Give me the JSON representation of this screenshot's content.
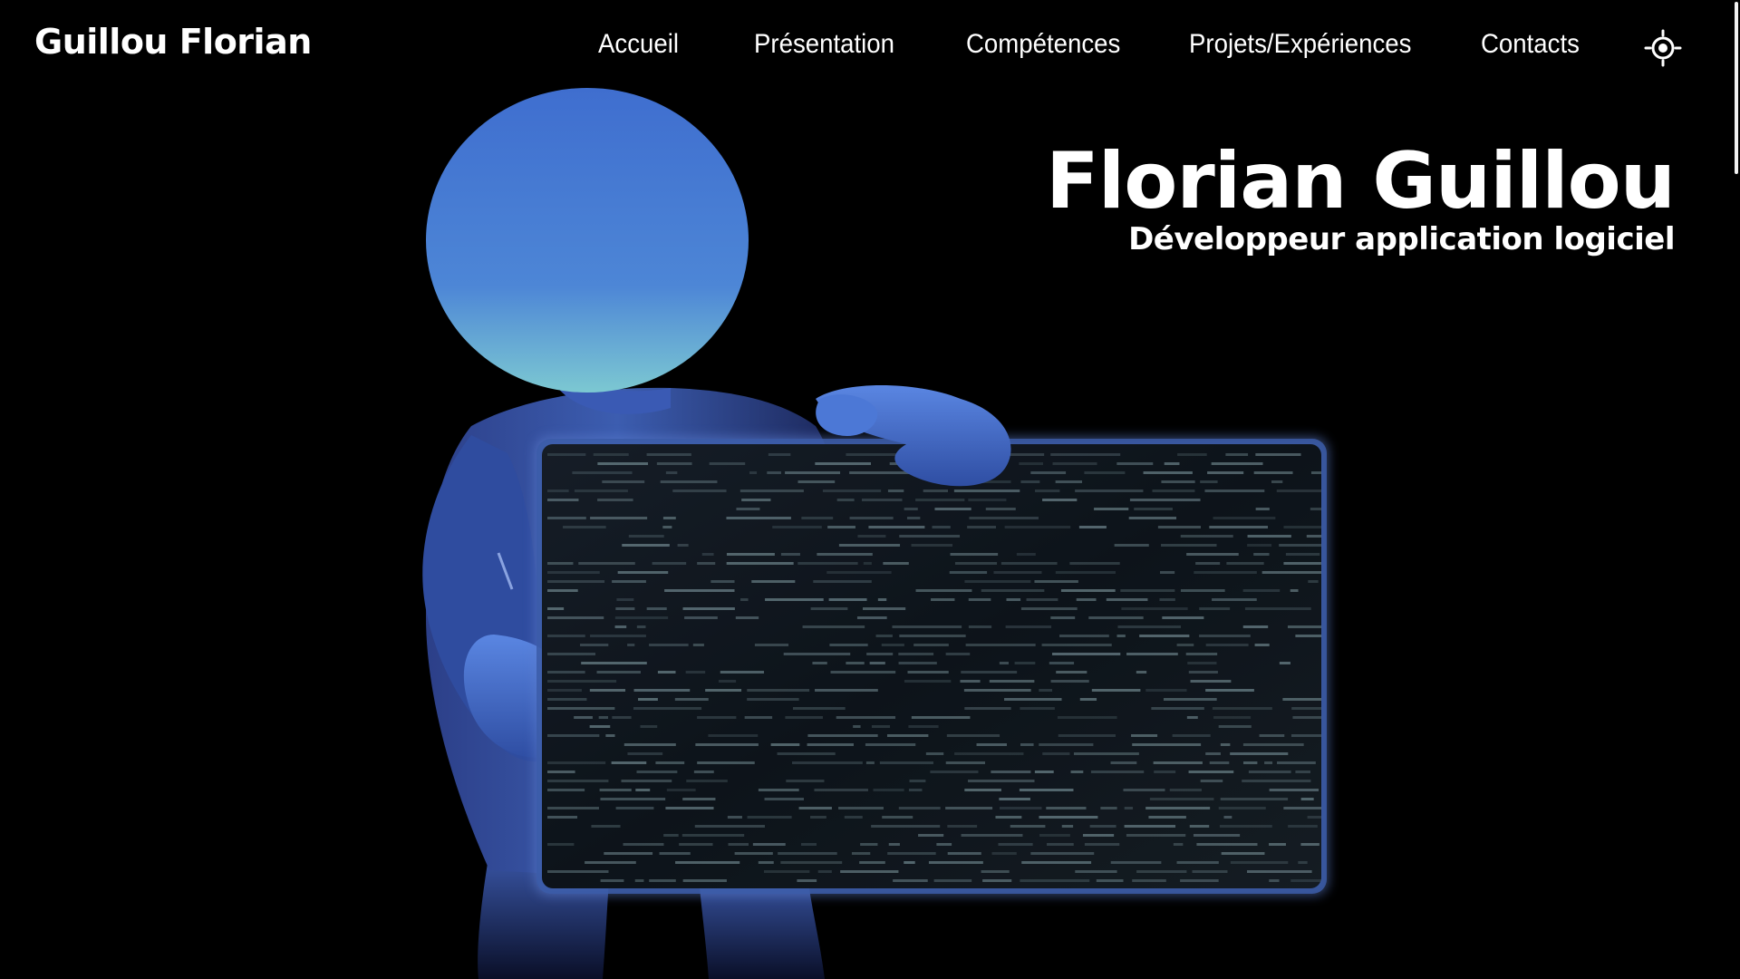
{
  "header": {
    "brand": "Guillou Florian",
    "nav": [
      {
        "label": "Accueil"
      },
      {
        "label": "Présentation"
      },
      {
        "label": "Compétences"
      },
      {
        "label": "Projets/Expériences"
      },
      {
        "label": "Contacts"
      }
    ],
    "theme_toggle_icon": "sun-icon"
  },
  "hero": {
    "name": "Florian Guillou",
    "role": "Développeur application logiciel",
    "illustration": "figure-holding-code-screen"
  },
  "colors": {
    "background": "#000000",
    "text": "#ffffff",
    "figure_glow": "#5b86e0",
    "screen_code": "#9fc0c8"
  }
}
